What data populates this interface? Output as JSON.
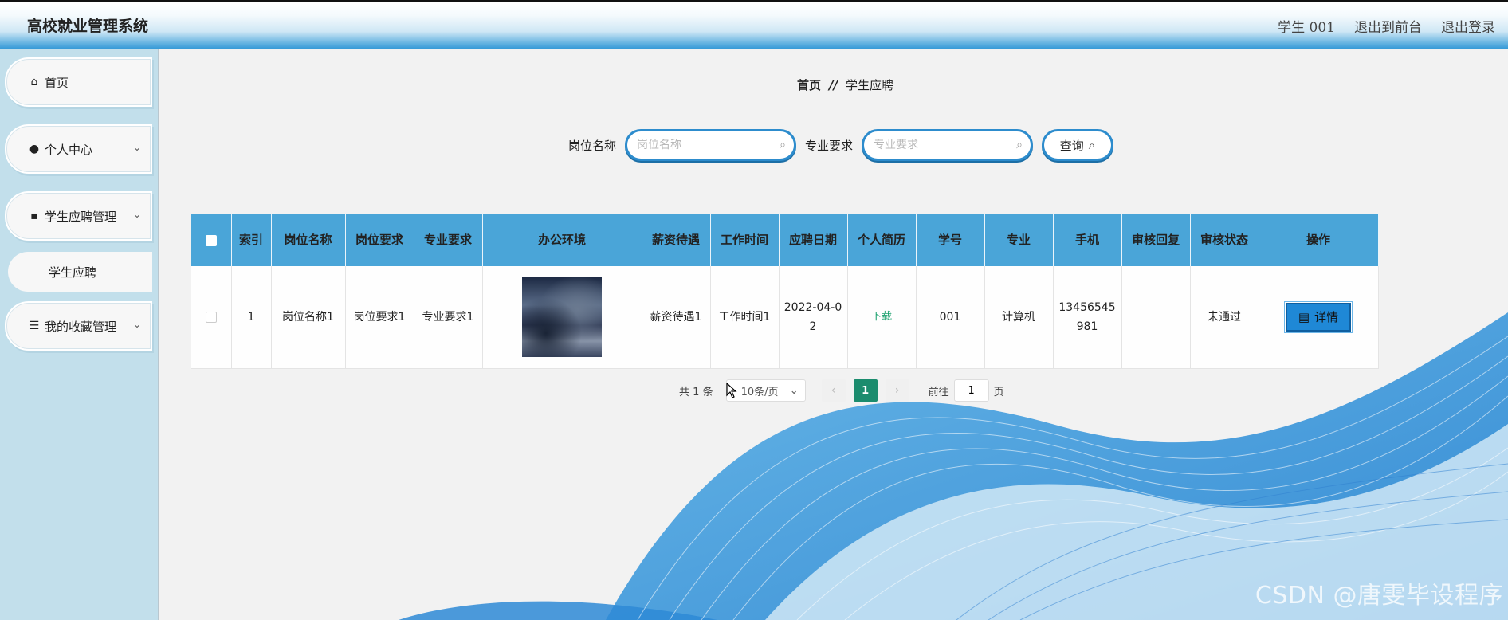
{
  "app": {
    "title": "高校就业管理系统",
    "user": "学生  001",
    "to_front": "退出到前台",
    "logout": "退出登录"
  },
  "sidebar": {
    "items": [
      {
        "label": "首页",
        "icon": "home-icon"
      },
      {
        "label": "个人中心",
        "icon": "person-icon",
        "expandable": true
      },
      {
        "label": "学生应聘管理",
        "icon": "message-icon",
        "expandable": true,
        "expanded": true
      },
      {
        "label": "我的收藏管理",
        "icon": "list-icon",
        "expandable": true
      }
    ],
    "sub_items": [
      {
        "label": "学生应聘"
      }
    ]
  },
  "breadcrumb": {
    "home": "首页",
    "separator": "//",
    "current": "学生应聘"
  },
  "search": {
    "job_label": "岗位名称",
    "job_placeholder": "岗位名称",
    "major_label": "专业要求",
    "major_placeholder": "专业要求",
    "query_button": "查询"
  },
  "table": {
    "headers": [
      "索引",
      "岗位名称",
      "岗位要求",
      "专业要求",
      "办公环境",
      "薪资待遇",
      "工作时间",
      "应聘日期",
      "个人简历",
      "学号",
      "专业",
      "手机",
      "审核回复",
      "审核状态",
      "操作"
    ],
    "rows": [
      {
        "index": "1",
        "job_name": "岗位名称1",
        "job_req": "岗位要求1",
        "major_req": "专业要求1",
        "salary": "薪资待遇1",
        "work_time": "工作时间1",
        "apply_date": "2022-04-02",
        "resume": "下载",
        "student_no": "001",
        "major": "计算机",
        "phone": "13456545981",
        "review_reply": "",
        "review_status": "未通过",
        "action": "详情"
      }
    ]
  },
  "pagination": {
    "total_prefix": "共",
    "total": "1",
    "total_suffix": "条",
    "page_size": "10条/页",
    "current_page": "1",
    "goto_label": "前往",
    "goto_value": "1",
    "goto_suffix": "页"
  },
  "watermark": "CSDN @唐雯毕设程序",
  "colors": {
    "header_blue": "#4aa5d8",
    "sidebar_bg": "#c2dfeb",
    "accent_green": "#1b8c6e",
    "detail_button": "#1f88d6"
  }
}
